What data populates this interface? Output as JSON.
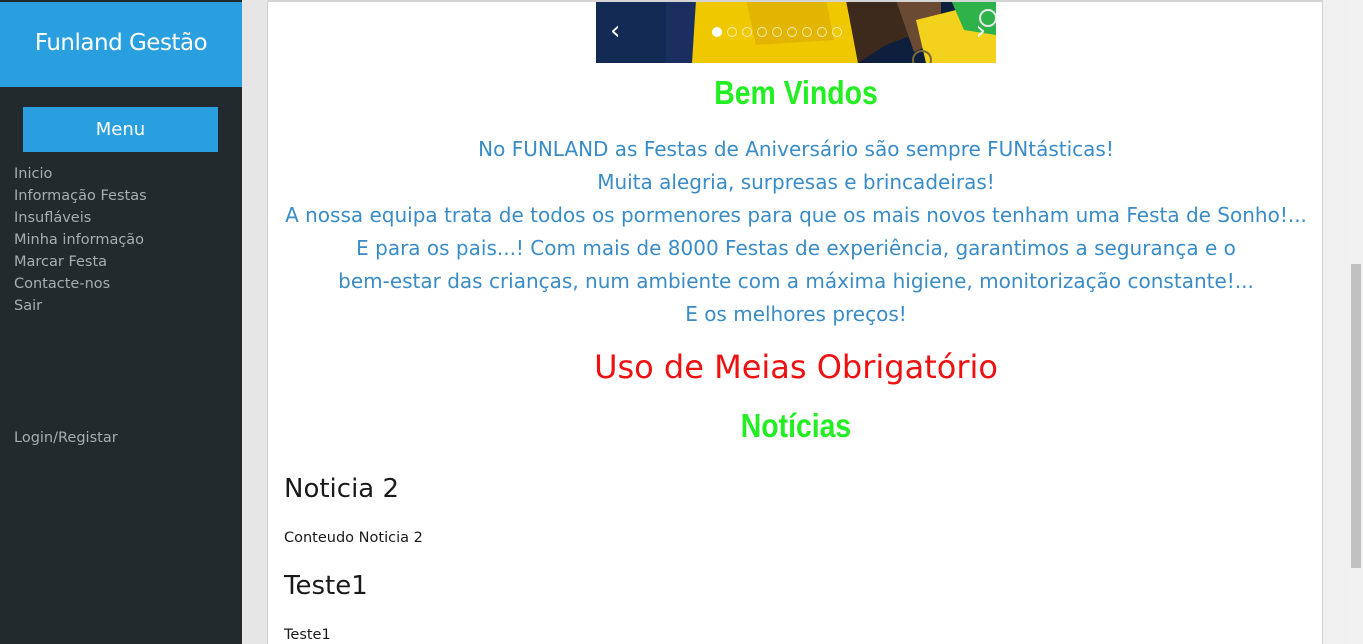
{
  "sidebar": {
    "brand": "Funland Gestão",
    "menu_label": "Menu",
    "items": [
      {
        "label": "Inicio"
      },
      {
        "label": "Informação Festas"
      },
      {
        "label": "Insufláveis"
      },
      {
        "label": "Minha informação"
      },
      {
        "label": "Marcar Festa"
      },
      {
        "label": "Contacte-nos"
      },
      {
        "label": "Sair"
      }
    ],
    "login": "Login/Registar"
  },
  "carousel": {
    "prev": "‹",
    "next": "›",
    "dot_count": 9,
    "active_index": 0
  },
  "welcome": {
    "title": "Bem Vindos",
    "lines": [
      "No FUNLAND as Festas de Aniversário são sempre FUNtásticas!",
      "Muita alegria, surpresas e brincadeiras!",
      "A nossa equipa trata de todos os pormenores para que os mais novos tenham uma Festa de Sonho!...",
      "E para os pais...! Com mais de 8000 Festas de experiência, garantimos a segurança e o",
      "bem-estar das crianças, num ambiente com a máxima higiene, monitorização constante!...",
      "E os melhores preços!"
    ]
  },
  "notice": "Uso de Meias Obrigatório",
  "news": {
    "title": "Notícias",
    "items": [
      {
        "title": "Noticia 2",
        "body": "Conteudo Noticia 2"
      },
      {
        "title": "Teste1",
        "body": "Teste1"
      }
    ]
  },
  "colors": {
    "sidebar_bg": "#222a2d",
    "accent_blue": "#2a9fe0",
    "heading_green": "#22ee22",
    "text_blue": "#3a8cc6",
    "notice_red": "#ee1111"
  }
}
